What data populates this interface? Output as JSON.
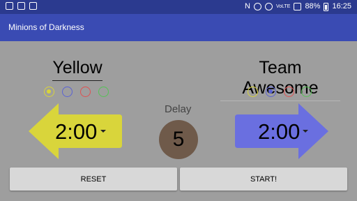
{
  "status_bar": {
    "left_icons": [
      "notification-icon",
      "gallery-icon",
      "briefcase-icon"
    ],
    "nfc": "N",
    "signal_label": "VoLTE",
    "battery": "88%",
    "time": "16:25"
  },
  "app": {
    "title": "Minions of Darkness"
  },
  "left_team": {
    "name": "Yellow",
    "time": "2:00",
    "color": "#d9d53b",
    "selected_color": "yellow",
    "colors": [
      {
        "name": "yellow",
        "hex": "#d8d43a",
        "selected": true
      },
      {
        "name": "blue",
        "hex": "#5a62d4",
        "selected": false
      },
      {
        "name": "red",
        "hex": "#e05050",
        "selected": false
      },
      {
        "name": "green",
        "hex": "#55c255",
        "selected": false
      }
    ]
  },
  "right_team": {
    "name": "Team Awesome",
    "time": "2:00",
    "color": "#6a6fe0",
    "selected_color": "blue",
    "colors": [
      {
        "name": "yellow",
        "hex": "#d8d43a",
        "selected": false
      },
      {
        "name": "blue",
        "hex": "#5a62d4",
        "selected": true
      },
      {
        "name": "red",
        "hex": "#e05050",
        "selected": false
      },
      {
        "name": "green",
        "hex": "#55c255",
        "selected": false
      }
    ]
  },
  "delay": {
    "label": "Delay",
    "value": "5"
  },
  "buttons": {
    "reset": "RESET",
    "start": "START!"
  }
}
